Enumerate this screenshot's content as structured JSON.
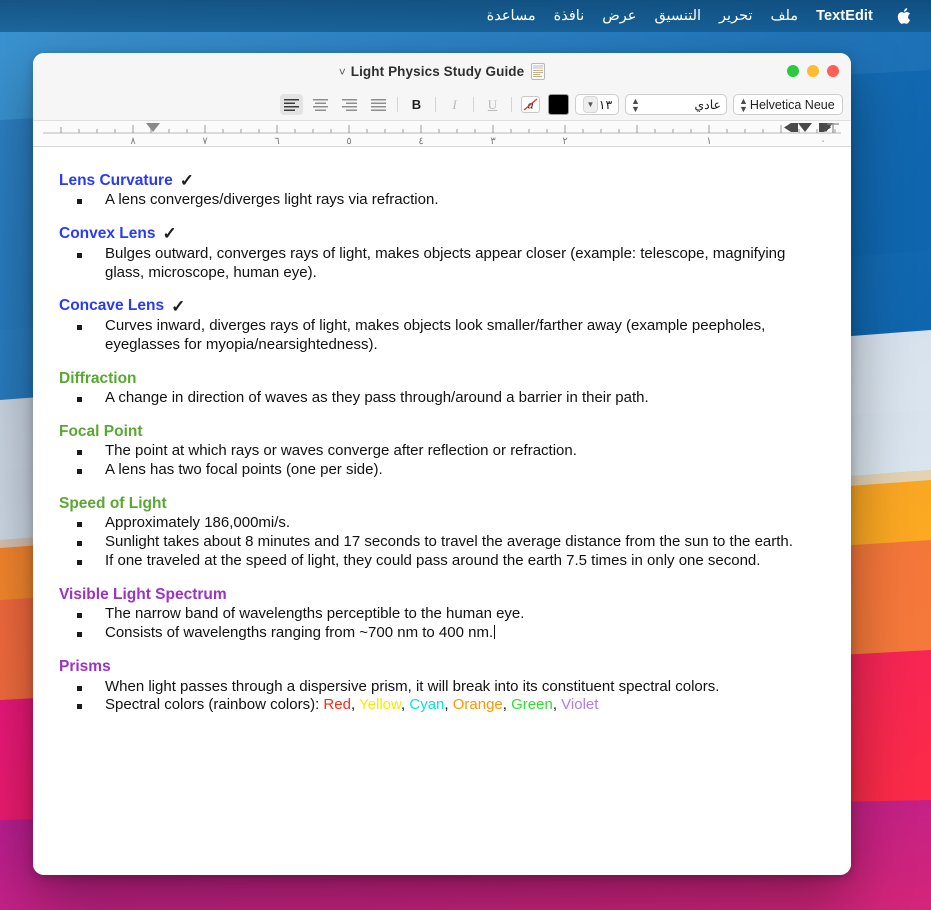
{
  "menubar": {
    "apple_icon": "apple-logo-icon",
    "items": [
      {
        "label": "TextEdit",
        "bold": true
      },
      {
        "label": "ملف",
        "bold": false
      },
      {
        "label": "تحرير",
        "bold": false
      },
      {
        "label": "التنسيق",
        "bold": false
      },
      {
        "label": "عرض",
        "bold": false
      },
      {
        "label": "نافذة",
        "bold": false
      },
      {
        "label": "مساعدة",
        "bold": false
      }
    ]
  },
  "window": {
    "title": "Light Physics Study Guide",
    "title_chevron": "chevron-down-icon",
    "doc_icon": "document-icon",
    "traffic_lights": [
      {
        "name": "zoom-button",
        "color": "#2cc83f"
      },
      {
        "name": "minimize-button",
        "color": "#febc2e"
      },
      {
        "name": "close-button",
        "color": "#ff5f57"
      }
    ]
  },
  "toolbar": {
    "font_family": "Helvetica Neue",
    "font_style": "عادي",
    "font_size": "١٣",
    "text_color": "#000000",
    "stepper_glyph": "⌃⌄",
    "buttons": [
      {
        "name": "align-left-button",
        "label": "align-left-icon",
        "active": true
      },
      {
        "name": "align-center-button",
        "label": "align-center-icon",
        "active": false
      },
      {
        "name": "align-right-button",
        "label": "align-right-icon",
        "active": false
      },
      {
        "name": "align-justify-button",
        "label": "align-justify-icon",
        "active": false
      },
      {
        "name": "bold-button",
        "label": "B",
        "active": false
      },
      {
        "name": "italic-button",
        "label": "I",
        "active": false
      },
      {
        "name": "underline-button",
        "label": "U",
        "active": false
      }
    ],
    "bold_label": "B",
    "italic_label": "I",
    "underline_label": "U",
    "clear_style_label": "a"
  },
  "ruler": {
    "numbers": [
      "٨",
      "٧",
      "٦",
      "٥",
      "٤",
      "٣",
      "٢",
      "١",
      "٠"
    ],
    "markers": [
      "first-line-indent-marker",
      "right-indent-marker",
      "left-indent-marker",
      "tab-stop-marker"
    ]
  },
  "document": {
    "sections": [
      {
        "heading": "Lens Curvature",
        "color": "#2a3bf5",
        "check": "✓",
        "bullets": [
          {
            "text": "A lens converges/diverges light rays via refraction."
          }
        ]
      },
      {
        "heading": "Convex Lens",
        "color": "#2a3bf5",
        "check": "✓",
        "bullets": [
          {
            "text": "Bulges outward, converges rays of light, makes objects appear closer (example: telescope, magnifying glass, microscope, human eye)."
          }
        ]
      },
      {
        "heading": "Concave Lens",
        "color": "#2a3bf5",
        "check": "✓",
        "bullets": [
          {
            "text": "Curves inward, diverges rays of light, makes objects look smaller/farther away (example peepholes, eyeglasses for myopia/nearsightedness)."
          }
        ]
      },
      {
        "heading": "Diffraction",
        "color": "#5aa832",
        "check": "",
        "bullets": [
          {
            "text": "A change in direction of waves as they pass through/around a barrier in their path."
          }
        ]
      },
      {
        "heading": "Focal Point",
        "color": "#5aa832",
        "check": "",
        "bullets": [
          {
            "text": "The point at which rays or waves converge after reflection or refraction."
          },
          {
            "text": "A lens has two focal points (one per side)."
          }
        ]
      },
      {
        "heading": "Speed of Light",
        "color": "#5aa832",
        "check": "",
        "bullets": [
          {
            "text": "Approximately 186,000mi/s."
          },
          {
            "text": "Sunlight takes about 8 minutes and 17 seconds to travel the average distance from the sun to the earth."
          },
          {
            "text": "If one traveled at the speed of light, they could pass around the earth 7.5 times in only one second."
          }
        ]
      },
      {
        "heading": "Visible Light Spectrum",
        "color": "#9b33c4",
        "check": "",
        "bullets": [
          {
            "text": "The narrow band of wavelengths perceptible to the human eye."
          },
          {
            "text": "Consists of wavelengths ranging from ~700 nm to 400 nm.",
            "caret": true
          }
        ]
      },
      {
        "heading": "Prisms",
        "color": "#9b33c4",
        "check": "",
        "bullets": [
          {
            "text": "When light passes through a dispersive prism, it will break into its constituent spectral colors."
          },
          {
            "text": "Spectral colors (rainbow colors): ",
            "rainbow": [
              {
                "word": "Red",
                "color": "#ff2a14"
              },
              {
                "word": "Yellow",
                "color": "#ffe800"
              },
              {
                "word": "Cyan",
                "color": "#00e5e5"
              },
              {
                "word": "Orange",
                "color": "#ff9500"
              },
              {
                "word": "Green",
                "color": "#2ee02e"
              },
              {
                "word": "Violet",
                "color": "#b07cf0"
              }
            ],
            "separator": ", "
          }
        ]
      }
    ]
  },
  "wallpaper": {
    "name": "big-sur-gradient-wallpaper",
    "bands": [
      "#2a7fc0",
      "#1b6fb5",
      "#c9d6e4",
      "#f8a72c",
      "#f0703d",
      "#f12a5a",
      "#c51e86"
    ]
  }
}
